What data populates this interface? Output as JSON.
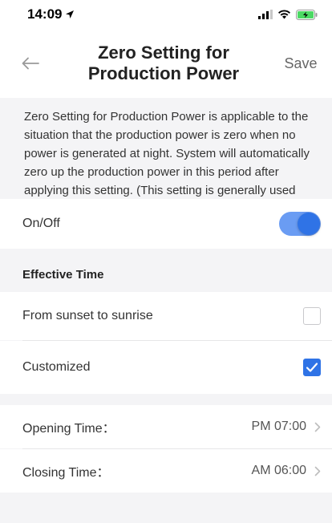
{
  "status_bar": {
    "time": "14:09",
    "icons": [
      "location-arrow-icon",
      "signal-icon",
      "wifi-icon",
      "battery-charging-icon"
    ]
  },
  "header": {
    "title_line1": "Zero Setting for",
    "title_line2": "Production Power",
    "save_label": "Save",
    "back_icon": "back-arrow-icon"
  },
  "description": "Zero Setting for Production Power is applicable to the situation that the production power is zero when no power is generated at night. System will automatically zero up the production power in this period after applying this setting. (This setting is generally used for self-consumption system.)",
  "on_off": {
    "label": "On/Off",
    "enabled": true
  },
  "effective_time": {
    "section_title": "Effective Time",
    "options": [
      {
        "label": "From sunset to sunrise",
        "checked": false
      },
      {
        "label": "Customized",
        "checked": true
      }
    ]
  },
  "times": [
    {
      "label": "Opening Time：",
      "value": "PM 07:00"
    },
    {
      "label": "Closing Time：",
      "value": "AM 06:00"
    }
  ],
  "colors": {
    "accent": "#2f73e6",
    "toggle_track": "#6a9cf3",
    "background": "#f4f4f6"
  }
}
